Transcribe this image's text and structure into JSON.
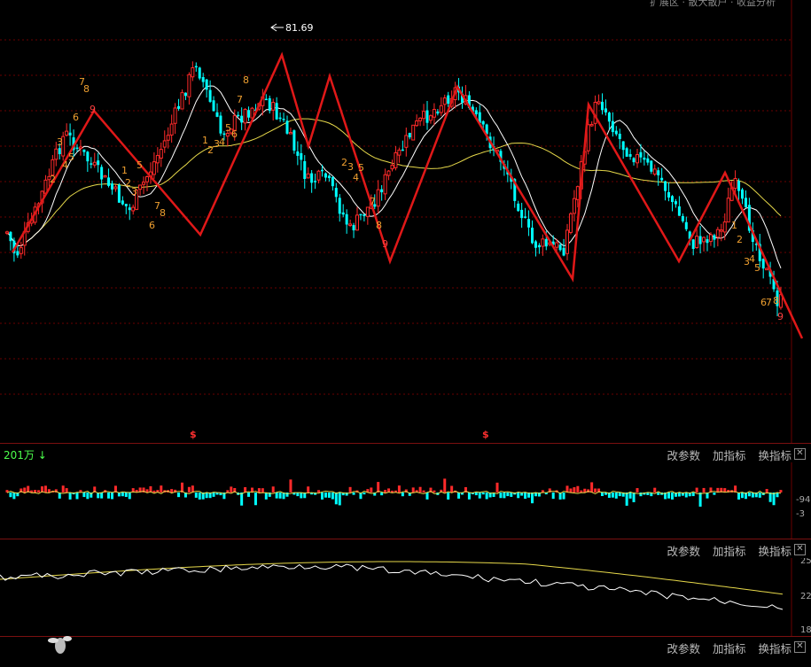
{
  "chart_data": {
    "type": "candlestick",
    "peak_label": "81.69",
    "signal_marks": [
      "$",
      "$"
    ],
    "td_counts": [
      "3",
      "2",
      "4",
      "5",
      "7",
      "8",
      "6",
      "9",
      "1",
      "2",
      "3",
      "5",
      "7",
      "8",
      "6",
      "1",
      "2",
      "3",
      "4",
      "5",
      "6",
      "7",
      "8",
      "2",
      "3",
      "4",
      "5",
      "7",
      "8",
      "9",
      "1",
      "2",
      "3",
      "4",
      "5",
      "6",
      "7",
      "8",
      "9"
    ],
    "volume_label": "201万",
    "volume_axis": [
      "-94",
      "-3"
    ],
    "indicator_axis": [
      "25",
      "22",
      "18"
    ]
  },
  "toolbar": {
    "change_params": "改参数",
    "add_indicator": "加指标",
    "switch_indicator": "换指标",
    "close": "✕"
  },
  "top_menu": [
    "扩展区",
    "散大散户",
    "收益分析"
  ],
  "colors": {
    "up": "#ff2a2a",
    "down": "#00ffff",
    "ma_short": "#ffffff",
    "ma_long": "#e6d84a",
    "zigzag": "#e01818",
    "grid": "#6a0000"
  }
}
